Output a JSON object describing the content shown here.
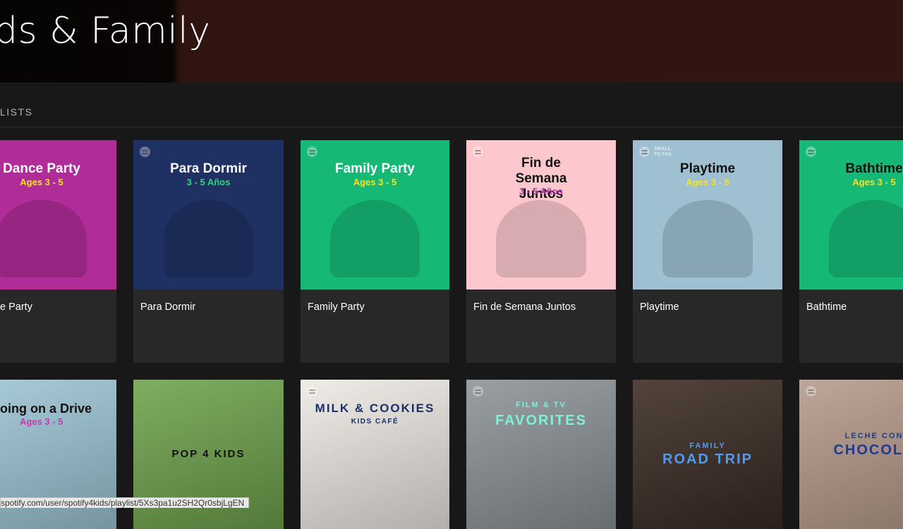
{
  "header": {
    "title": "ds & Family"
  },
  "section": {
    "label": "LISTS"
  },
  "row1": [
    {
      "name": "Dance Party",
      "cover_title": "Dance Party",
      "cover_sub": "Ages 3 - 5",
      "caption": "e Party",
      "bg": "#b02c98",
      "title_color": "#ffffff",
      "sub_color": "#f5e12b"
    },
    {
      "name": "Para Dormir",
      "cover_title": "Para Dormir",
      "cover_sub": "3 - 5 Años",
      "caption": "Para Dormir",
      "bg": "#1f3163",
      "title_color": "#ffffff",
      "sub_color": "#2fd37a"
    },
    {
      "name": "Family Party",
      "cover_title": "Family Party",
      "cover_sub": "Ages 3 - 5",
      "caption": "Family Party",
      "bg": "#15b875",
      "title_color": "#ffffff",
      "sub_color": "#f5e12b"
    },
    {
      "name": "Fin de Semana Juntos",
      "cover_title": "Fin de Semana Juntos",
      "cover_sub": "3 - 5 Años",
      "caption": "Fin de Semana Juntos",
      "bg": "#fcc8cd",
      "title_color": "#111111",
      "sub_color": "#b53aa9"
    },
    {
      "name": "Playtime",
      "cover_title": "Playtime",
      "cover_sub": "Ages 3 - 5",
      "caption": "Playtime",
      "bg": "#9ec0d1",
      "title_color": "#111111",
      "sub_color": "#f5e12b",
      "badge": "SMALL TO FAIL"
    },
    {
      "name": "Bathtime",
      "cover_title": "Bathtime",
      "cover_sub": "Ages 3 - 5",
      "caption": "Bathtime",
      "bg": "#15b875",
      "title_color": "#111111",
      "sub_color": "#f5e12b"
    }
  ],
  "row2": [
    {
      "name": "Going on a Drive",
      "cover_title": "oing on a Drive",
      "cover_sub": "Ages 3 - 5",
      "bg": "#9ec6d6",
      "title_color": "#111111",
      "sub_color": "#c23bb0"
    },
    {
      "name": "Pop 4 Kids",
      "cover_title": "POP 4 KIDS",
      "bg": "#6fa24c",
      "title_color": "#111111"
    },
    {
      "name": "Milk & Cookies",
      "cover_title": "MILK & COOKIES",
      "cover_sub": "KIDS CAFÉ",
      "bg": "#eeeae4",
      "title_color": "#1c2f6b",
      "sub_color": "#1c2f6b"
    },
    {
      "name": "Film & TV Favorites",
      "cover_pre": "FILM & TV",
      "cover_title": "FAVORITES",
      "bg": "#8b9296",
      "title_color": "#7ff0d9",
      "sub_color": "#7ff0d9"
    },
    {
      "name": "Family Road Trip",
      "cover_pre": "FAMILY",
      "cover_title": "ROAD TRIP",
      "bg": "#3a2a22",
      "title_color": "#4f9bf0",
      "sub_color": "#4f9bf0"
    },
    {
      "name": "Leche con Chocolate",
      "cover_pre": "LECHE CON",
      "cover_title": "CHOCOLA",
      "bg": "#b59a8a",
      "title_color": "#1f3a8c",
      "sub_color": "#1f3a8c"
    }
  ],
  "statusbar": {
    "url": "spotify.com/user/spotify4kids/playlist/5Xs3pa1u2SH2Qr0sbjLgEN"
  }
}
